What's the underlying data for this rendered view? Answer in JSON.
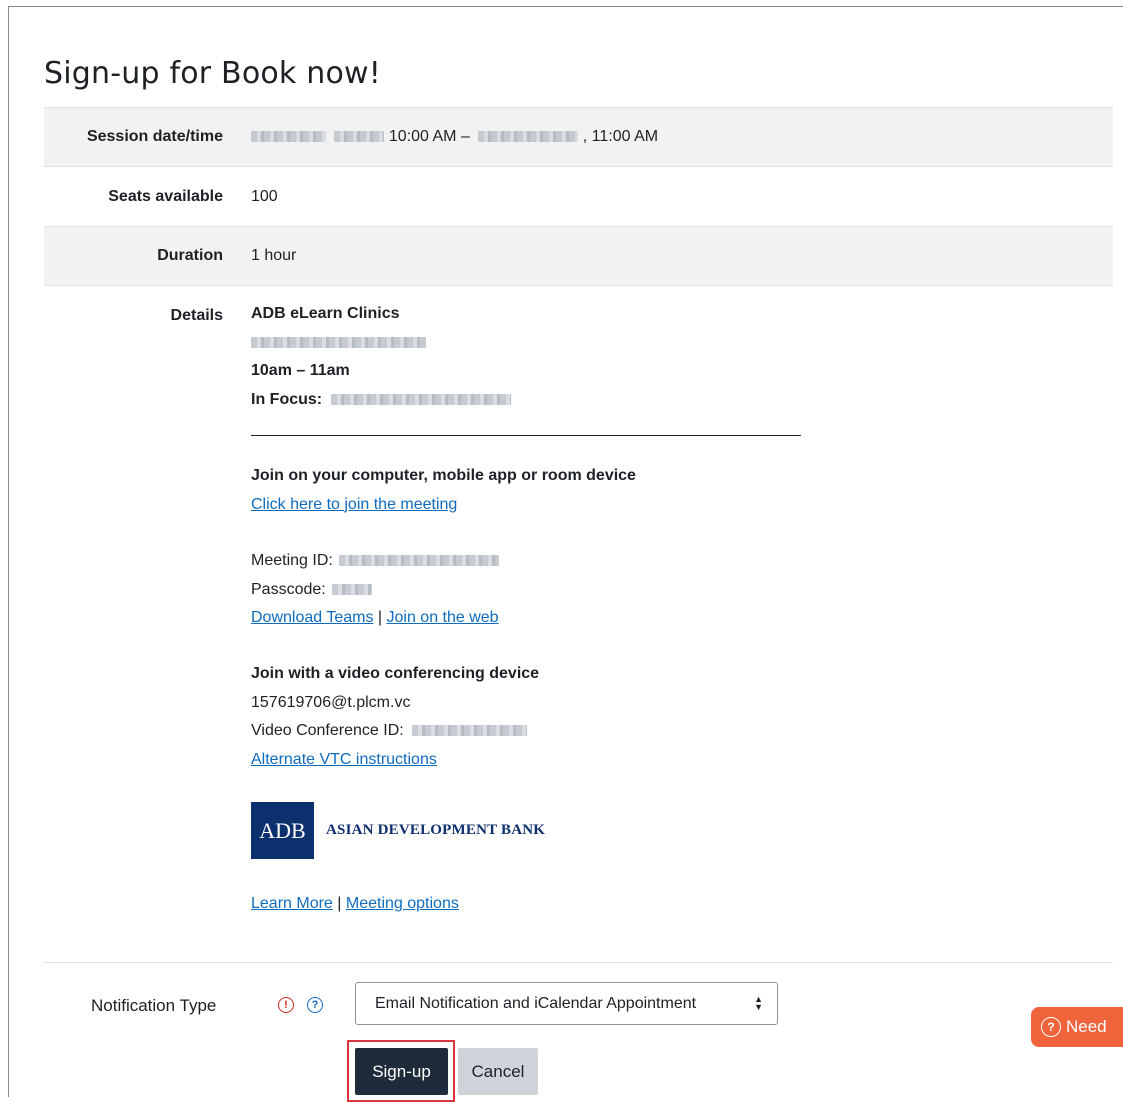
{
  "page": {
    "title": "Sign-up for Book now!"
  },
  "session": {
    "rows": [
      {
        "label": "Session date/time",
        "value_start": "10:00 AM –",
        "value_end": ", 11:00 AM"
      },
      {
        "label": "Seats available",
        "value": "100"
      },
      {
        "label": "Duration",
        "value": "1 hour"
      },
      {
        "label": "Details"
      }
    ]
  },
  "details": {
    "heading": "ADB eLearn Clinics",
    "time": "10am – 11am",
    "in_focus_label": "In Focus:",
    "join_heading": "Join on your computer, mobile app or room device",
    "join_link": "Click here to join the meeting",
    "meeting_id_label": "Meeting ID:",
    "passcode_label": "Passcode:",
    "download_teams": "Download Teams",
    "pipe": "|",
    "join_web": "Join on the web",
    "vtc_heading": "Join with a video conferencing device",
    "vtc_address": "157619706@t.plcm.vc",
    "vtc_id_label": "Video Conference ID:",
    "vtc_alt": "Alternate VTC instructions",
    "learn_more": "Learn More",
    "meeting_options": "Meeting options"
  },
  "logo": {
    "mark": "ADB",
    "name": "ASIAN DEVELOPMENT BANK"
  },
  "form": {
    "notification_label": "Notification Type",
    "required_glyph": "!",
    "help_glyph": "?",
    "selected_option": "Email Notification and iCalendar Appointment",
    "signup_button": "Sign-up",
    "cancel_button": "Cancel"
  },
  "help_widget": {
    "glyph": "?",
    "label": "Need"
  },
  "colors": {
    "link": "#0f6cbf",
    "primary_button": "#1d2b3a",
    "help_widget": "#f0643c",
    "highlight": "#d9363e",
    "logo": "#0c2f6e"
  }
}
